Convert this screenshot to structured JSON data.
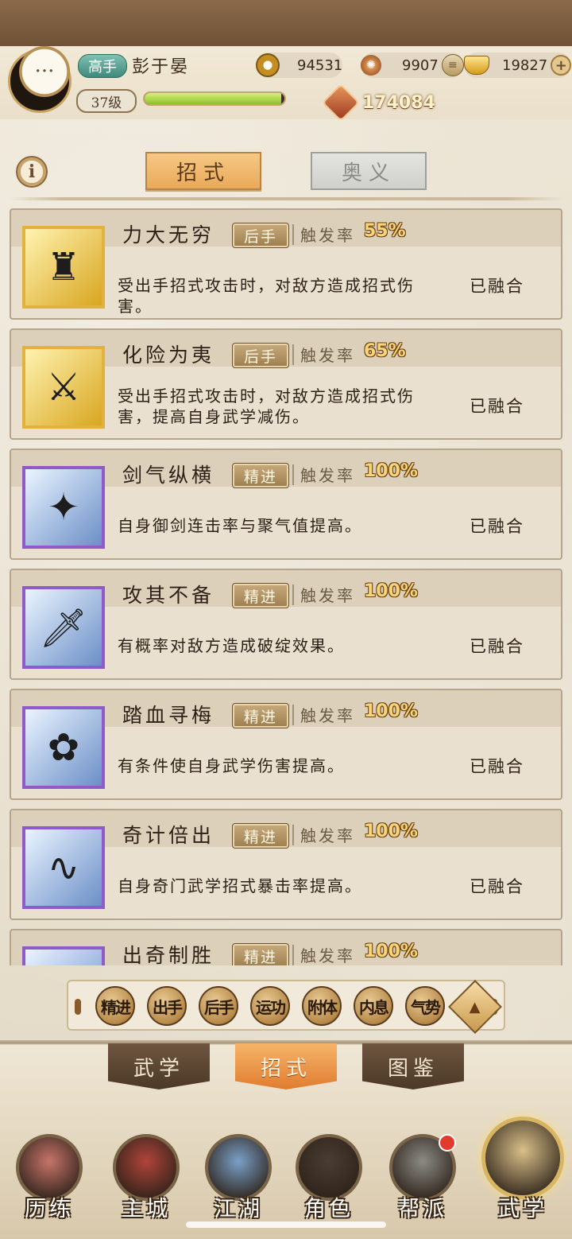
{
  "player": {
    "rank": "高手",
    "name": "彭于晏",
    "level": "37级",
    "exp_fraction": 0.98,
    "power": "174084"
  },
  "resources": {
    "coins": "94531",
    "energy": "9907",
    "ingots": "19827"
  },
  "tabs": {
    "active": "招式",
    "inactive": "奥义"
  },
  "skills": [
    {
      "name": "力大无穷",
      "type": "后手",
      "trigger_label": "触发率",
      "rate": "55%",
      "desc": "受出手招式攻击时，对敌方造成招式伤害。",
      "status": "已融合",
      "frame": "gold",
      "icon": "strongman-icon"
    },
    {
      "name": "化险为夷",
      "type": "后手",
      "trigger_label": "触发率",
      "rate": "65%",
      "desc": "受出手招式攻击时，对敌方造成招式伤害，提高自身武学减伤。",
      "status": "已融合",
      "frame": "gold",
      "icon": "chain-warrior-icon"
    },
    {
      "name": "剑气纵横",
      "type": "精进",
      "trigger_label": "触发率",
      "rate": "100%",
      "desc": "自身御剑连击率与聚气值提高。",
      "status": "已融合",
      "frame": "purple",
      "icon": "sword-burst-icon"
    },
    {
      "name": "攻其不备",
      "type": "精进",
      "trigger_label": "触发率",
      "rate": "100%",
      "desc": "有概率对敌方造成破绽效果。",
      "status": "已融合",
      "frame": "purple",
      "icon": "leaping-swordsman-icon"
    },
    {
      "name": "踏血寻梅",
      "type": "精进",
      "trigger_label": "触发率",
      "rate": "100%",
      "desc": "有条件使自身武学伤害提高。",
      "status": "已融合",
      "frame": "purple",
      "icon": "plum-blossom-icon"
    },
    {
      "name": "奇计倍出",
      "type": "精进",
      "trigger_label": "触发率",
      "rate": "100%",
      "desc": "自身奇门武学招式暴击率提高。",
      "status": "已融合",
      "frame": "purple",
      "icon": "scroll-icon"
    },
    {
      "name": "出奇制胜",
      "type": "精进",
      "trigger_label": "触发率",
      "rate": "100%",
      "desc": "",
      "status": "",
      "frame": "purple",
      "icon": "blade-icon"
    }
  ],
  "filters": [
    {
      "text": "精进",
      "name": "filter-jingjin"
    },
    {
      "text": "出手",
      "name": "filter-chushou"
    },
    {
      "text": "后手",
      "name": "filter-houshou"
    },
    {
      "text": "运功",
      "name": "filter-yungong"
    },
    {
      "text": "附体",
      "name": "filter-futi"
    },
    {
      "text": "内息",
      "name": "filter-neixi"
    },
    {
      "text": "气势",
      "name": "filter-qishi"
    }
  ],
  "subtabs": [
    "武学",
    "招式",
    "图鉴"
  ],
  "nav": [
    {
      "label": "历练",
      "icon": "training-icon",
      "color": "#c7746a"
    },
    {
      "label": "主城",
      "icon": "city-gate-icon",
      "color": "#b0443a"
    },
    {
      "label": "江湖",
      "icon": "jianghu-icon",
      "color": "#7aa0c8"
    },
    {
      "label": "角色",
      "icon": "hat-character-icon",
      "color": "#4a3d33"
    },
    {
      "label": "帮派",
      "icon": "guild-emblem-icon",
      "color": "#8b8a85"
    },
    {
      "label": "武学",
      "icon": "scrolls-icon",
      "color": "#d9c089"
    }
  ],
  "colors": {
    "accent": "#e9a95a",
    "rate_gold": "#f8d47a",
    "gold_frame": "#e2b23c",
    "purple_frame": "#8f5ac9"
  }
}
